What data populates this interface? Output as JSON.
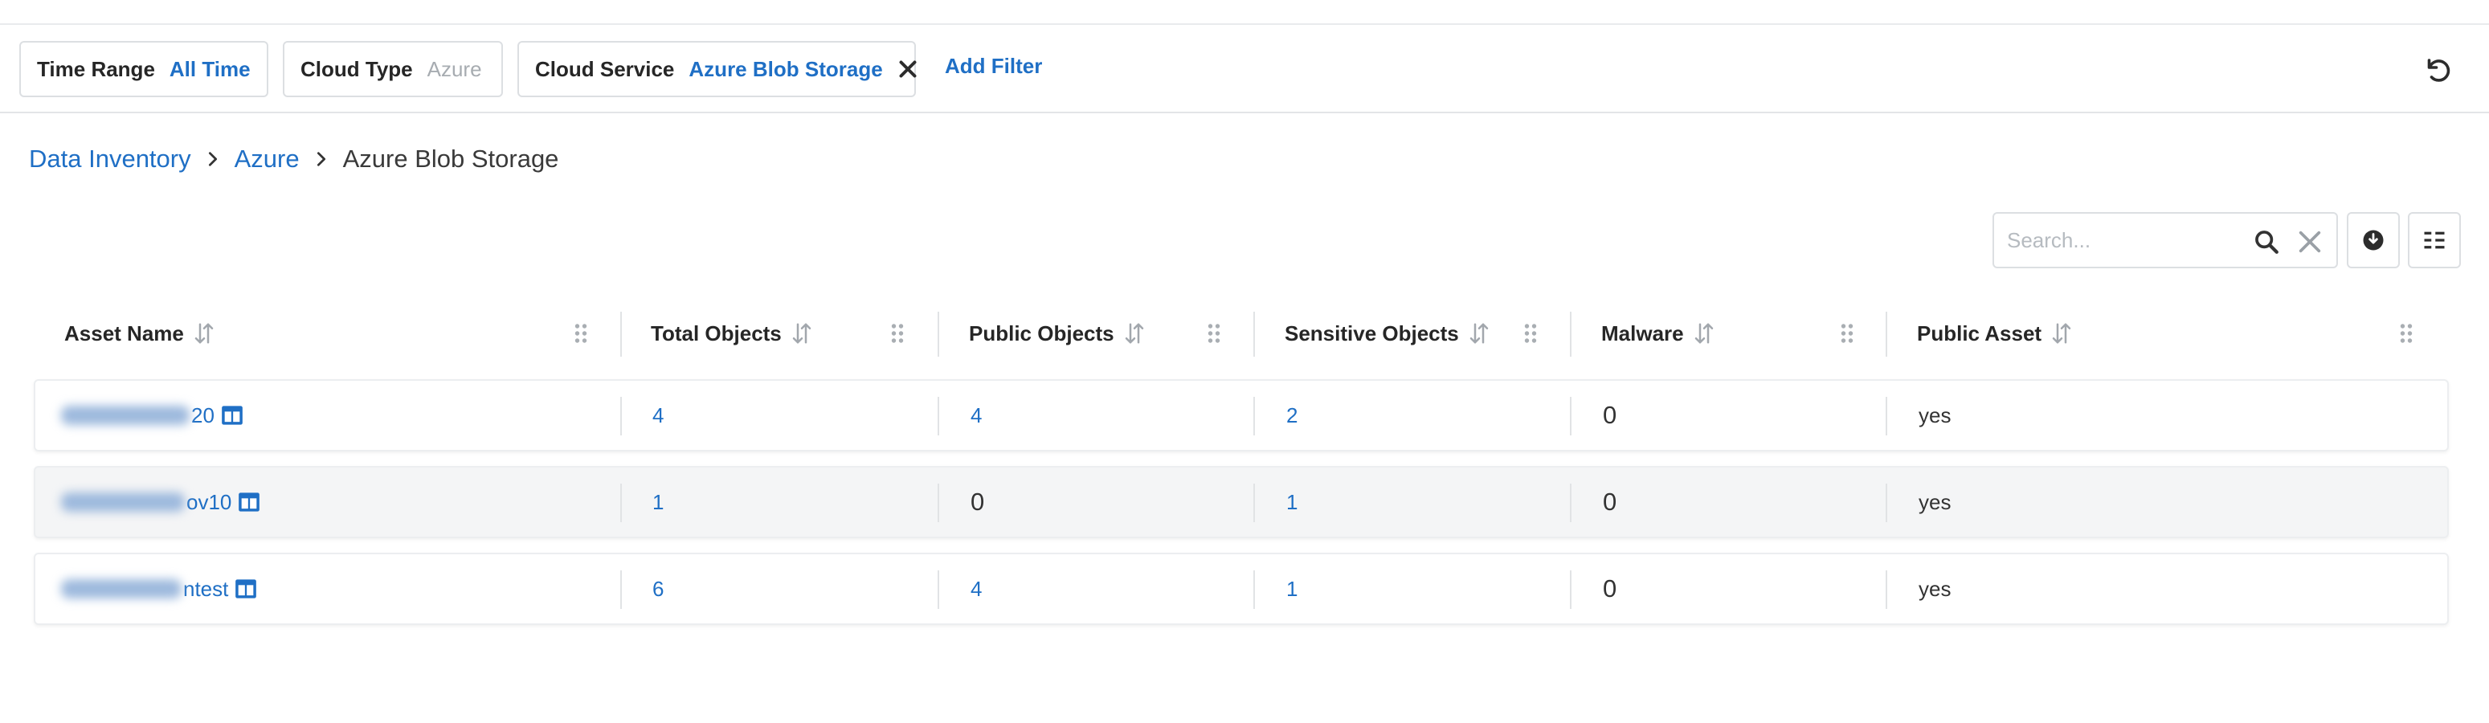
{
  "filters": {
    "time_range": {
      "label": "Time Range",
      "value": "All Time"
    },
    "cloud_type": {
      "label": "Cloud Type",
      "value": "Azure"
    },
    "cloud_service": {
      "label": "Cloud Service",
      "value": "Azure Blob Storage"
    },
    "add_filter": "Add Filter"
  },
  "breadcrumb": {
    "items": [
      "Data Inventory",
      "Azure"
    ],
    "current": "Azure Blob Storage"
  },
  "search": {
    "placeholder": "Search..."
  },
  "table": {
    "columns": [
      "Asset Name",
      "Total Objects",
      "Public Objects",
      "Sensitive Objects",
      "Malware",
      "Public Asset"
    ],
    "rows": [
      {
        "name_visible": "20",
        "total": "4",
        "public": "4",
        "sensitive": "2",
        "malware": "0",
        "public_asset": "yes"
      },
      {
        "name_visible": "ov10",
        "total": "1",
        "public": "0",
        "sensitive": "1",
        "malware": "0",
        "public_asset": "yes"
      },
      {
        "name_visible": "ntest",
        "total": "6",
        "public": "4",
        "sensitive": "1",
        "malware": "0",
        "public_asset": "yes"
      }
    ]
  },
  "icons": {
    "reset": "undo-icon",
    "search": "search-icon",
    "clear": "close-icon",
    "download": "download-icon",
    "columns": "column-list-icon",
    "sort": "sort-icon",
    "drag": "drag-handle-icon",
    "asset": "storage-icon"
  },
  "colors": {
    "accent": "#1f6fc5",
    "border": "#dcdfe2",
    "row_alt": "#f4f5f6"
  }
}
